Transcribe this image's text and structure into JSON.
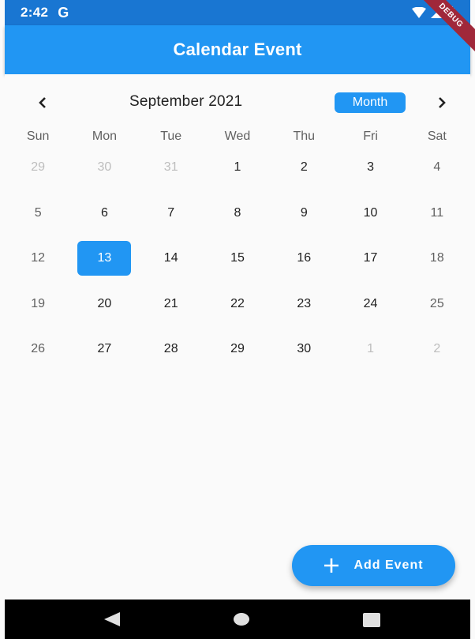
{
  "status_bar": {
    "time": "2:42",
    "carrier_icon": "google-g-icon",
    "debug_label": "DEBUG"
  },
  "app_bar": {
    "title": "Calendar Event"
  },
  "calendar": {
    "month_label": "September 2021",
    "format_button": "Month",
    "prev_icon": "chevron-left-icon",
    "next_icon": "chevron-right-icon",
    "weekdays": [
      "Sun",
      "Mon",
      "Tue",
      "Wed",
      "Thu",
      "Fri",
      "Sat"
    ],
    "weeks": [
      [
        "29",
        "30",
        "31",
        "1",
        "2",
        "3",
        "4"
      ],
      [
        "5",
        "6",
        "7",
        "8",
        "9",
        "10",
        "11"
      ],
      [
        "12",
        "13",
        "14",
        "15",
        "16",
        "17",
        "18"
      ],
      [
        "19",
        "20",
        "21",
        "22",
        "23",
        "24",
        "25"
      ],
      [
        "26",
        "27",
        "28",
        "29",
        "30",
        "1",
        "2"
      ]
    ],
    "selected_day": "13",
    "accent_color": "#2196f3"
  },
  "fab": {
    "label": "Add Event",
    "icon": "plus-icon"
  },
  "nav_bar": {
    "back_icon": "back-triangle-icon",
    "home_icon": "home-circle-icon",
    "recents_icon": "recents-square-icon"
  }
}
